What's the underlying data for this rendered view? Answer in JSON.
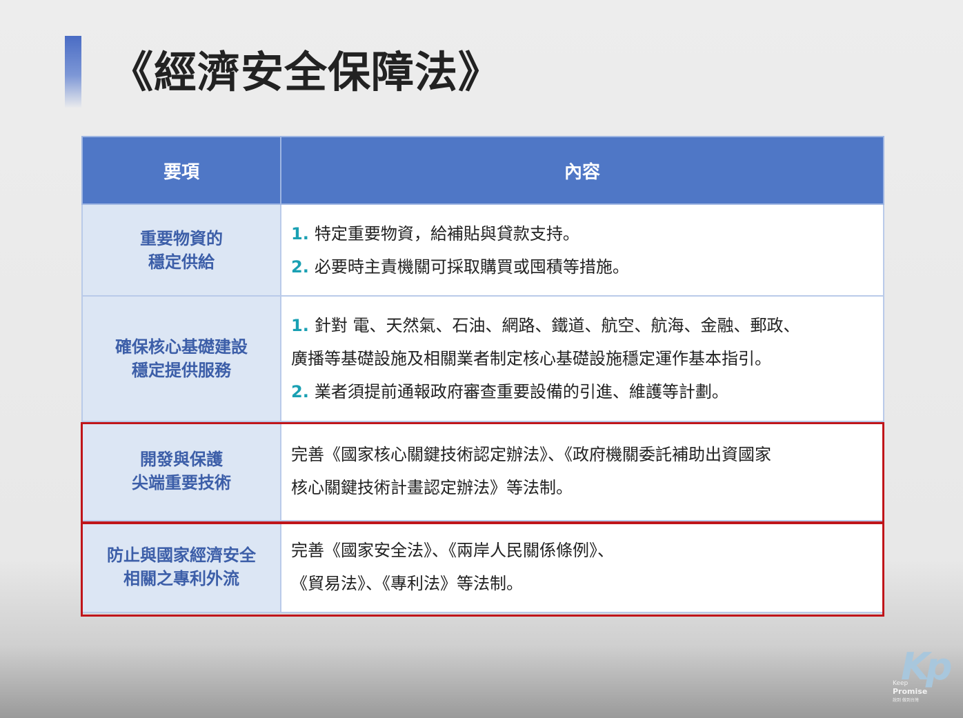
{
  "title": "《經濟安全保障法》",
  "table": {
    "headers": [
      "要項",
      "內容"
    ],
    "rows": [
      {
        "item": [
          "重要物資的",
          "穩定供給"
        ],
        "lines": [
          {
            "num": "1.",
            "text": "特定重要物資，給補貼與貸款支持。"
          },
          {
            "num": "2.",
            "text": "必要時主責機關可採取購買或囤積等措施。"
          }
        ]
      },
      {
        "item": [
          "確保核心基礎建設",
          "穩定提供服務"
        ],
        "lines": [
          {
            "num": "1.",
            "text": "針對 電、天然氣、石油、網路、鐵道、航空、航海、金融、郵政、"
          },
          {
            "num": "",
            "text": "廣播等基礎設施及相關業者制定核心基礎設施穩定運作基本指引。"
          },
          {
            "num": "2.",
            "text": "業者須提前通報政府審查重要設備的引進、維護等計劃。"
          }
        ]
      },
      {
        "item": [
          "開發與保護",
          "尖端重要技術"
        ],
        "lines": [
          {
            "num": "",
            "text": "完善《國家核心關鍵技術認定辦法》、《政府機關委託補助出資國家"
          },
          {
            "num": "",
            "text": "核心關鍵技術計畫認定辦法》等法制。"
          }
        ]
      },
      {
        "item": [
          "防止與國家經濟安全",
          "相關之專利外流"
        ],
        "lines": [
          {
            "num": "",
            "text": "完善《國家安全法》、《兩岸人民關係條例》、"
          },
          {
            "num": "",
            "text": "《貿易法》、《專利法》等法制。"
          }
        ]
      }
    ]
  },
  "highlighted_rows": [
    3,
    4
  ],
  "colors": {
    "header_bg": "#4f77c6",
    "item_bg": "#dce6f4",
    "item_text": "#3c5ea8",
    "number_accent": "#1aa0b3",
    "highlight_border": "#c0151a"
  },
  "logo": {
    "mark": "Kp",
    "line1": "Keep",
    "line2": "Promise",
    "line3": "說到 做到台灣"
  }
}
